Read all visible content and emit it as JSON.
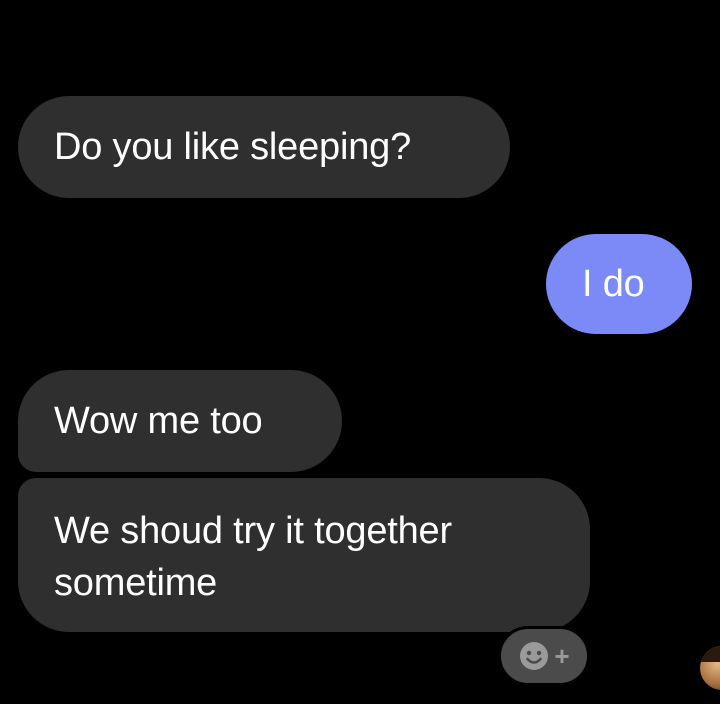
{
  "conversation": {
    "messages": [
      {
        "direction": "received",
        "text": "Do you like sleeping?"
      },
      {
        "direction": "sent",
        "text": "I do"
      },
      {
        "direction": "received",
        "text": "Wow me too"
      },
      {
        "direction": "received",
        "text": "We shoud try it together sometime"
      }
    ]
  },
  "reaction_button": {
    "icon": "add-reaction-icon",
    "plus": "+"
  },
  "colors": {
    "background": "#000000",
    "received_bubble": "#2f2f2f",
    "sent_bubble": "#7b8af6",
    "text": "#ffffff"
  }
}
